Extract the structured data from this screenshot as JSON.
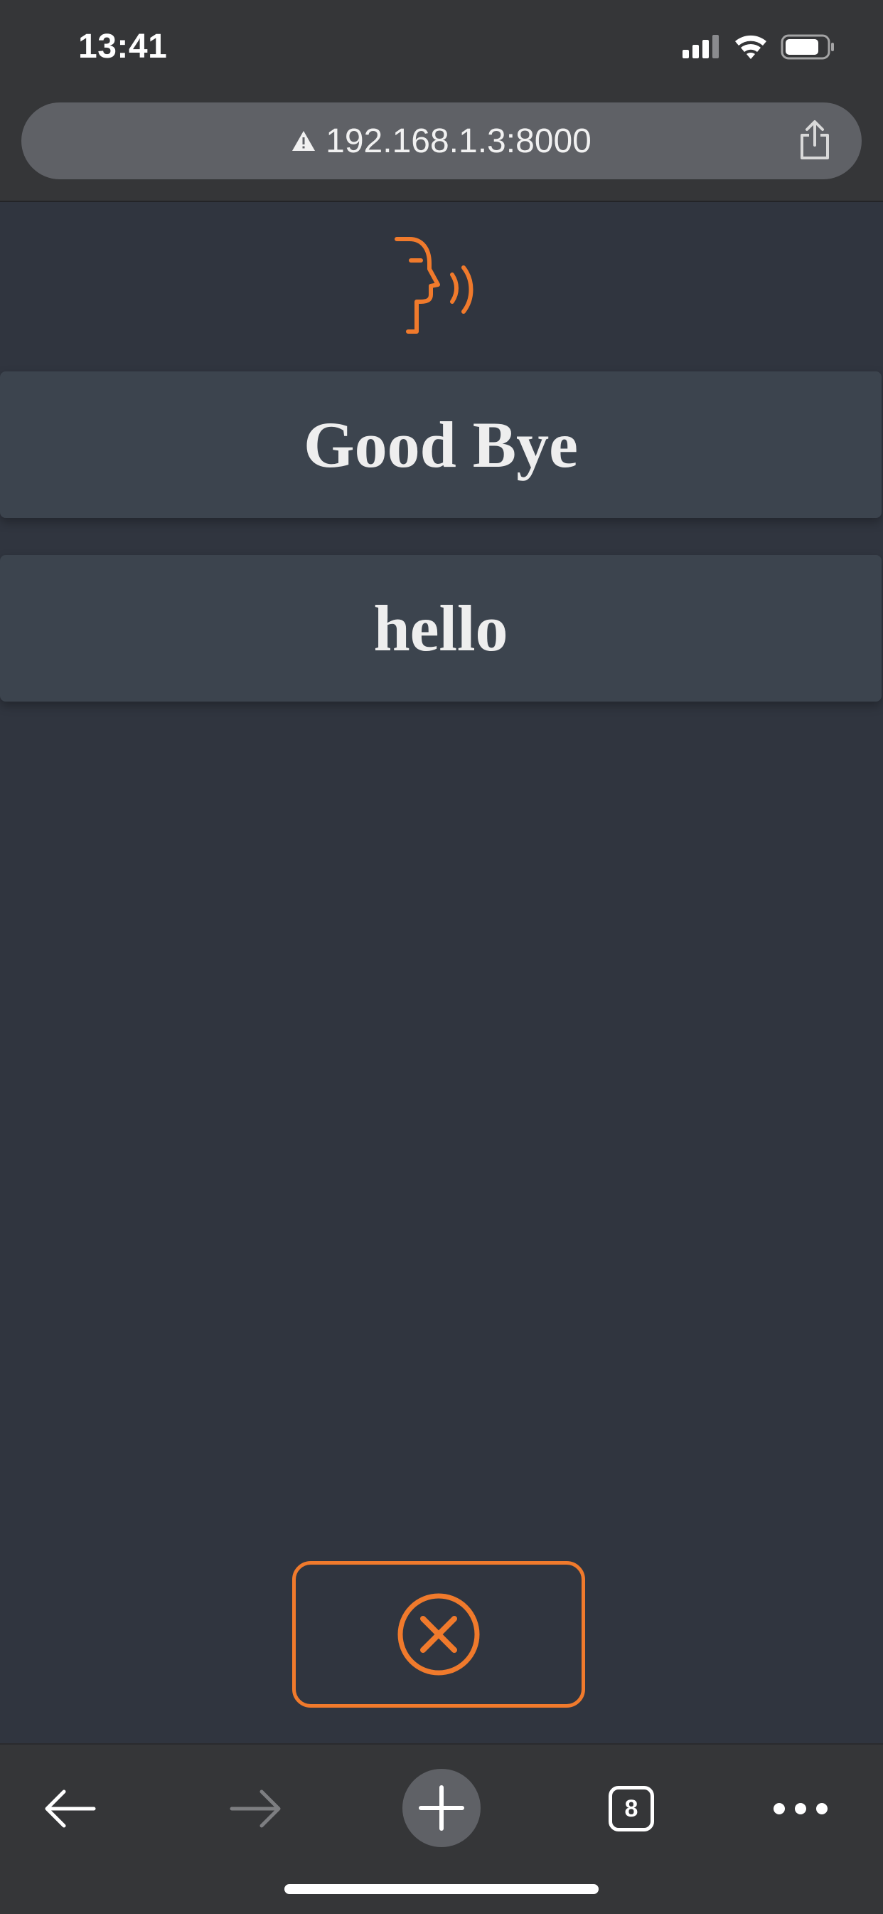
{
  "status_bar": {
    "time": "13:41"
  },
  "browser": {
    "url": "192.168.1.3:8000",
    "warning_icon": "warning-triangle-icon",
    "share_icon": "share-icon",
    "tab_count": "8"
  },
  "app": {
    "logo_icon": "speaking-head-icon",
    "accent_color": "#f07a2c",
    "phrases": [
      {
        "label": "Good Bye"
      },
      {
        "label": "hello"
      }
    ],
    "cancel_icon": "cancel-circle-icon"
  },
  "toolbar": {
    "back_icon": "back-arrow-icon",
    "forward_icon": "forward-arrow-icon",
    "new_tab_icon": "plus-icon",
    "menu_icon": "more-icon"
  }
}
